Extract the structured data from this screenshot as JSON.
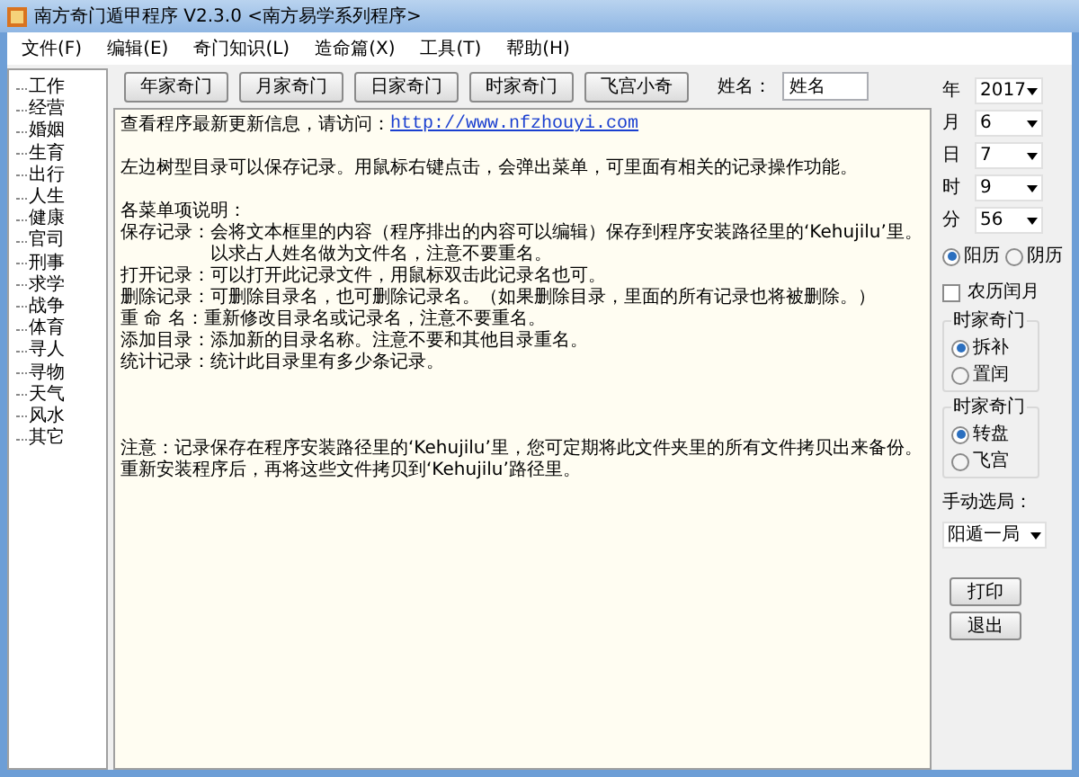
{
  "window": {
    "title": "南方奇门遁甲程序 V2.3.0  <南方易学系列程序>"
  },
  "menu": [
    "文件(F)",
    "编辑(E)",
    "奇门知识(L)",
    "造命篇(X)",
    "工具(T)",
    "帮助(H)"
  ],
  "tree": [
    "工作",
    "经营",
    "婚姻",
    "生育",
    "出行",
    "人生",
    "健康",
    "官司",
    "刑事",
    "求学",
    "战争",
    "体育",
    "寻人",
    "寻物",
    "天气",
    "风水",
    "其它"
  ],
  "toolbar": {
    "buttons": [
      "年家奇门",
      "月家奇门",
      "日家奇门",
      "时家奇门",
      "飞宫小奇"
    ],
    "name_label": "姓名：",
    "name_value": "姓名"
  },
  "text": {
    "intro": "查看程序最新更新信息，请访问：",
    "link": "http://www.nfzhouyi.com",
    "paragraphs": [
      {
        "lines": [
          {
            "kind": "line",
            "text": "左边树型目录可以保存记录。用鼠标右键点击，会弹出菜单，可里面有相关的记录操作功能。"
          }
        ]
      },
      {
        "lines": [
          {
            "kind": "line",
            "text": "各菜单项说明："
          },
          {
            "kind": "line",
            "text": "保存记录：会将文本框里的内容（程序排出的内容可以编辑）保存到程序安装路径里的‘Kehujilu’里。"
          },
          {
            "kind": "indent",
            "text": "以求占人姓名做为文件名，注意不要重名。"
          },
          {
            "kind": "line",
            "text": "打开记录：可以打开此记录文件，用鼠标双击此记录名也可。"
          },
          {
            "kind": "line",
            "text": "删除记录：可删除目录名，也可删除记录名。（如果删除目录，里面的所有记录也将被删除。）"
          },
          {
            "kind": "line",
            "text": "重 命 名：重新修改目录名或记录名，注意不要重名。"
          },
          {
            "kind": "line",
            "text": "添加目录：添加新的目录名称。注意不要和其他目录重名。"
          },
          {
            "kind": "line",
            "text": "统计记录：统计此目录里有多少条记录。"
          }
        ]
      },
      {
        "lines": [
          {
            "kind": "line",
            "text": "注意：记录保存在程序安装路径里的‘Kehujilu’里，您可定期将此文件夹里的所有文件拷贝出来备份。"
          },
          {
            "kind": "line",
            "text": "重新安装程序后，再将这些文件拷贝到‘Kehujilu’路径里。"
          }
        ]
      }
    ]
  },
  "date_fields": [
    {
      "label": "年",
      "value": "2017"
    },
    {
      "label": "月",
      "value": "6"
    },
    {
      "label": "日",
      "value": "7"
    },
    {
      "label": "时",
      "value": "9"
    },
    {
      "label": "分",
      "value": "56"
    }
  ],
  "calendar": [
    {
      "label": "阳历",
      "selected": true
    },
    {
      "label": "阴历",
      "selected": false
    }
  ],
  "leap_month": {
    "label": "农历闰月",
    "checked": false
  },
  "groups": [
    {
      "title": "时家奇门",
      "options": [
        {
          "label": "拆补",
          "selected": true
        },
        {
          "label": "置闰",
          "selected": false
        }
      ]
    },
    {
      "title": "时家奇门",
      "options": [
        {
          "label": "转盘",
          "selected": true
        },
        {
          "label": "飞宫",
          "selected": false
        }
      ]
    }
  ],
  "manual": {
    "label": "手动选局：",
    "value": "阳遁一局"
  },
  "buttons": [
    "打印",
    "退出"
  ]
}
